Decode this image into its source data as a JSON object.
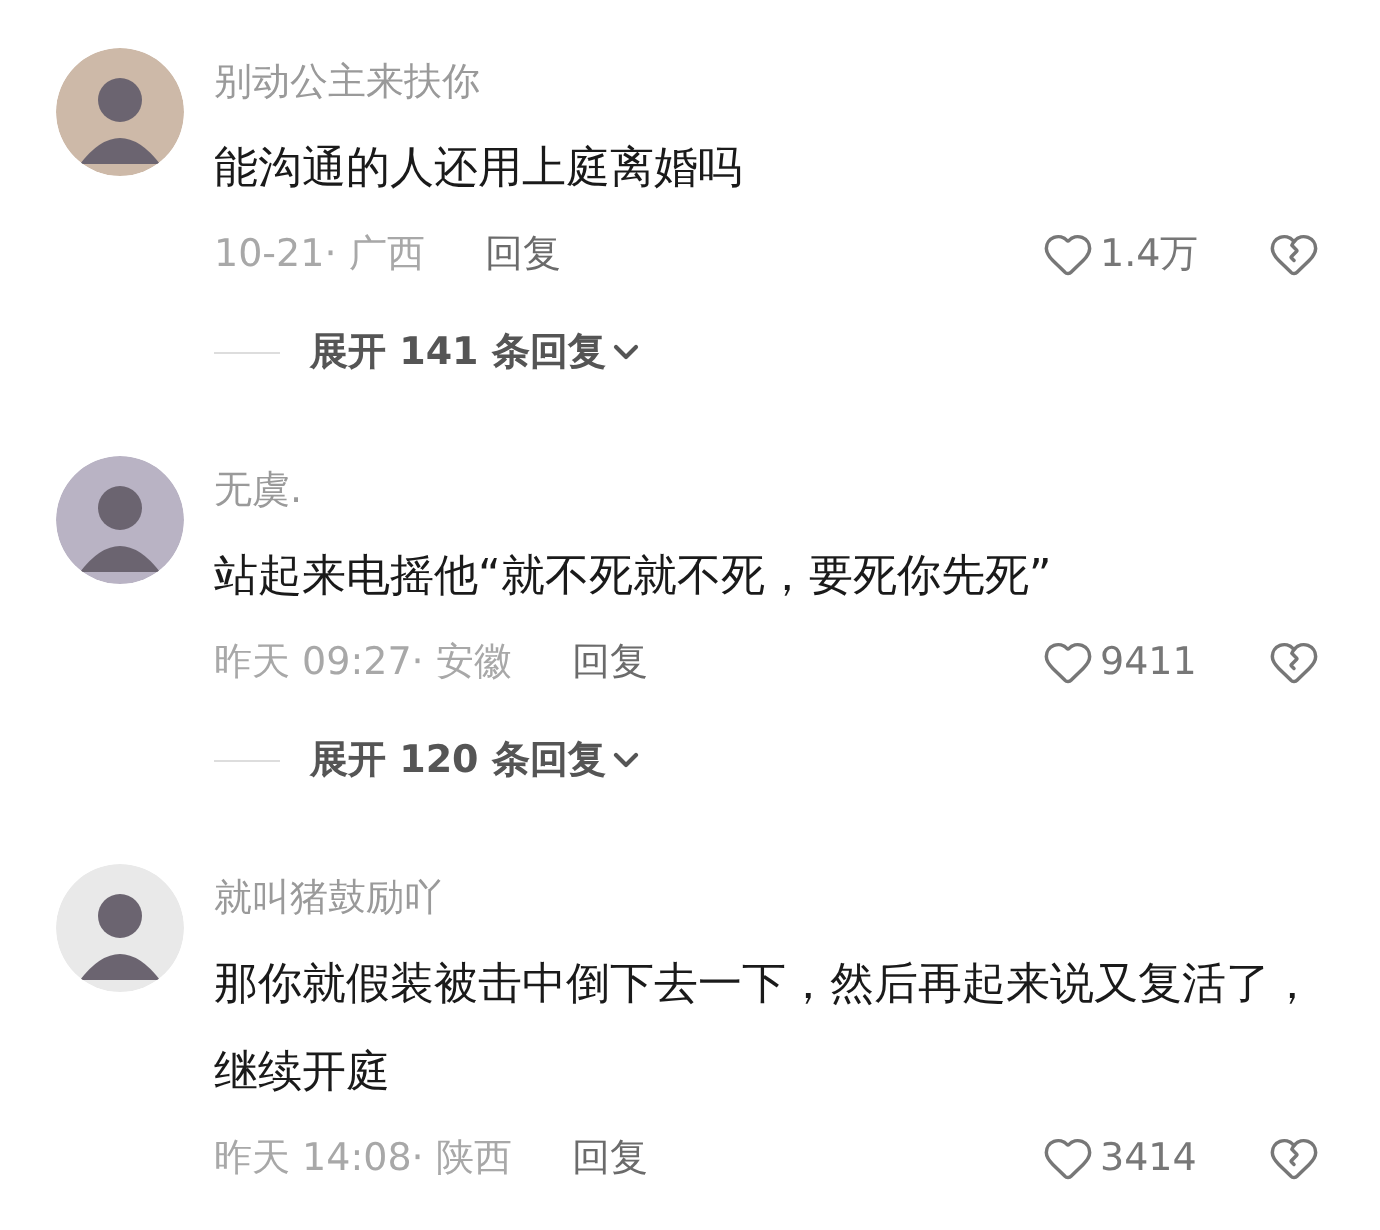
{
  "comments": [
    {
      "author": "别动公主来扶你",
      "text": "能沟通的人还用上庭离婚吗",
      "meta": "10-21· 广西",
      "reply": "回复",
      "likes": "1.4万",
      "expand": "展开 141 条回复"
    },
    {
      "author": "无虞.",
      "text": "站起来电摇他“就不死就不死，要死你先死”",
      "meta": "昨天 09:27· 安徽",
      "reply": "回复",
      "likes": "9411",
      "expand": "展开 120 条回复"
    },
    {
      "author": "就叫猪鼓励吖",
      "text": "那你就假装被击中倒下去一下，然后再起来说又复活了，继续开庭",
      "meta": "昨天 14:08· 陕西",
      "reply": "回复",
      "likes": "3414"
    }
  ]
}
